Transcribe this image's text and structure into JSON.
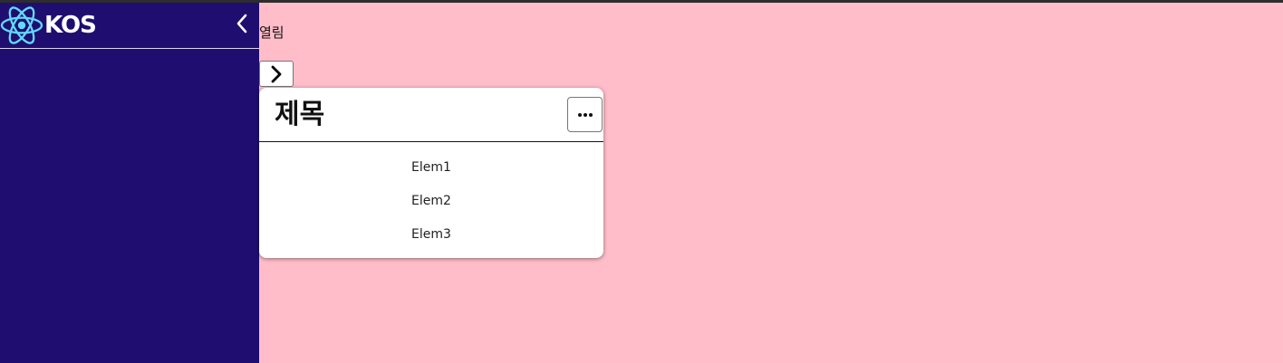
{
  "app": {
    "brand_name": "KOS",
    "logo_icon": "react-atom-icon",
    "colors": {
      "sidebar_bg": "#1f0e70",
      "page_bg": "#ffbdca",
      "logo": "#61dafb"
    }
  },
  "sidebar": {
    "collapse_icon": "chevron-left-icon"
  },
  "main": {
    "status_text": "열림",
    "expand_icon": "chevron-right-icon",
    "card": {
      "title": "제목",
      "menu_icon": "more-horizontal-icon",
      "items": [
        "Elem1",
        "Elem2",
        "Elem3"
      ]
    }
  }
}
